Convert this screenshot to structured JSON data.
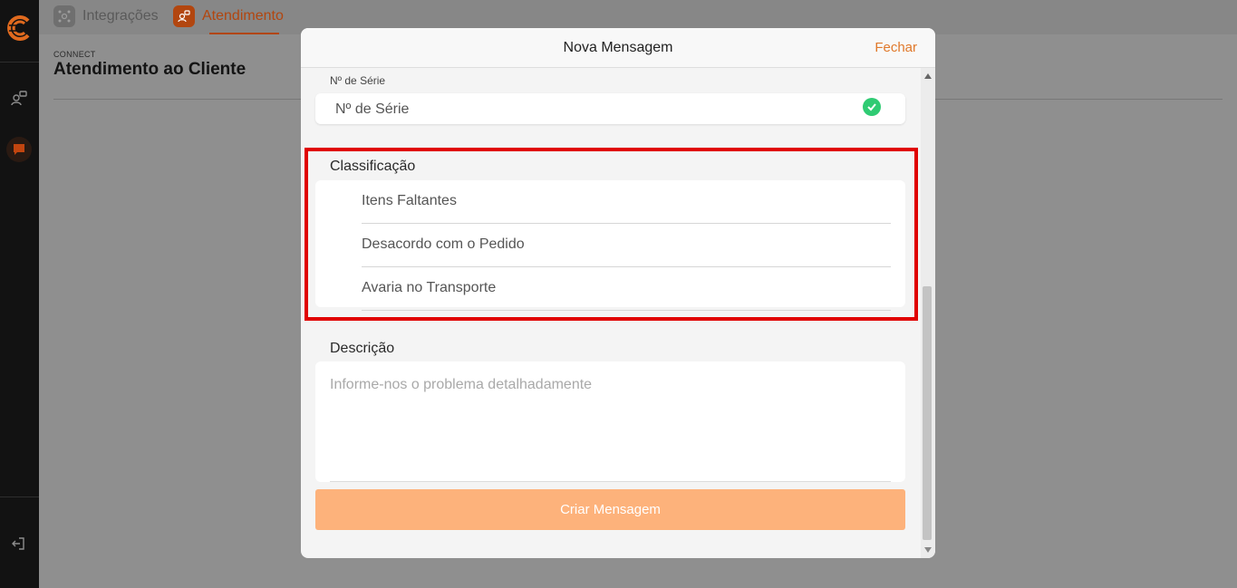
{
  "sidebar": {
    "logo": "company-logo",
    "items": [
      {
        "icon": "users-share-icon"
      },
      {
        "icon": "chat-bubble-icon",
        "active_color": "#c2450f"
      }
    ],
    "logout_icon": "logout-icon"
  },
  "topbar": {
    "tabs": [
      {
        "label": "Integrações",
        "icon": "integrations-icon"
      },
      {
        "label": "Atendimento",
        "icon": "support-icon",
        "active": true,
        "color": "#c2450f"
      }
    ]
  },
  "page": {
    "breadcrumb": "CONNECT",
    "title": "Atendimento ao Cliente"
  },
  "modal": {
    "title": "Nova Mensagem",
    "close_label": "Fechar",
    "serial": {
      "label": "Nº de Série",
      "value": "Nº de Série",
      "status_icon": "check-circle-icon"
    },
    "classification": {
      "title": "Classificação",
      "options": [
        "Itens Faltantes",
        "Desacordo com o Pedido",
        "Avaria no Transporte"
      ]
    },
    "description": {
      "title": "Descrição",
      "placeholder": "Informe-nos o problema detalhadamente"
    },
    "submit_label": "Criar Mensagem",
    "accent_color": "#e0792b",
    "highlight_color": "#e00000"
  }
}
